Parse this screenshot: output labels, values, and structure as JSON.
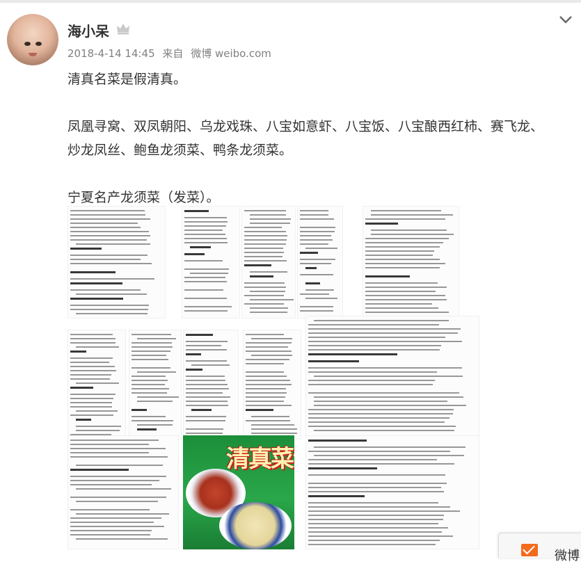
{
  "post": {
    "username": "海小呆",
    "date": "2018-4-14 14:45",
    "source_prefix": "来自",
    "source": "微博 weibo.com",
    "paragraphs": [
      "清真名菜是假清真。",
      "凤凰寻窝、双凤朝阳、乌龙戏珠、八宝如意虾、八宝饭、八宝酿西红柿、赛飞龙、炒龙凤丝、鲍鱼龙须菜、鸭条龙须菜。",
      "宁夏名产龙须菜（发菜）。"
    ],
    "images": [
      {
        "kind": "page"
      },
      {
        "kind": "page"
      },
      {
        "kind": "page"
      },
      {
        "kind": "page"
      },
      {
        "kind": "page"
      },
      {
        "kind": "page"
      },
      {
        "kind": "page"
      },
      {
        "kind": "page"
      },
      {
        "kind": "page"
      },
      {
        "kind": "page"
      },
      {
        "kind": "page"
      },
      {
        "kind": "cover",
        "title": "清真菜谱"
      },
      {
        "kind": "page"
      },
      {
        "kind": "page"
      }
    ]
  },
  "icons": {
    "crown": "crown-icon",
    "chevron": "chevron-down-icon",
    "mail": "mail-icon"
  },
  "float_button": {
    "label": "微博"
  },
  "colors": {
    "accent": "#f36b1c",
    "meta": "#808080",
    "text": "#333333"
  }
}
